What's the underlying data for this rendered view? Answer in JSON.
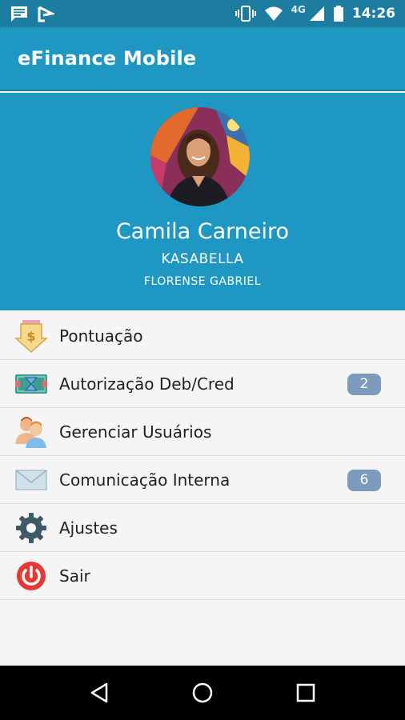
{
  "status_bar": {
    "time": "14:26",
    "network": "4G",
    "icons": [
      "message-icon",
      "app-notification-icon",
      "vibrate-icon",
      "wifi-icon",
      "signal-icon",
      "battery-icon"
    ]
  },
  "app_bar": {
    "title": "eFinance Mobile"
  },
  "profile": {
    "name": "Camila Carneiro",
    "company": "KASABELLA",
    "subtitle": "FLORENSE GABRIEL"
  },
  "menu": {
    "items": [
      {
        "label": "Pontuação",
        "icon": "dollar-arrow-icon",
        "badge": ""
      },
      {
        "label": "Autorização Deb/Cred",
        "icon": "money-hourglass-icon",
        "badge": "2"
      },
      {
        "label": "Gerenciar Usuários",
        "icon": "users-icon",
        "badge": ""
      },
      {
        "label": "Comunicação Interna",
        "icon": "envelope-icon",
        "badge": "6"
      },
      {
        "label": "Ajustes",
        "icon": "gear-icon",
        "badge": ""
      },
      {
        "label": "Sair",
        "icon": "power-icon",
        "badge": ""
      }
    ]
  },
  "nav_bar": {
    "buttons": [
      "back-icon",
      "home-icon",
      "recents-icon"
    ]
  },
  "colors": {
    "primary": "#1f97c3",
    "status_bar": "#1d7da1",
    "badge": "#7c9bbd",
    "exit_red": "#e53935"
  }
}
